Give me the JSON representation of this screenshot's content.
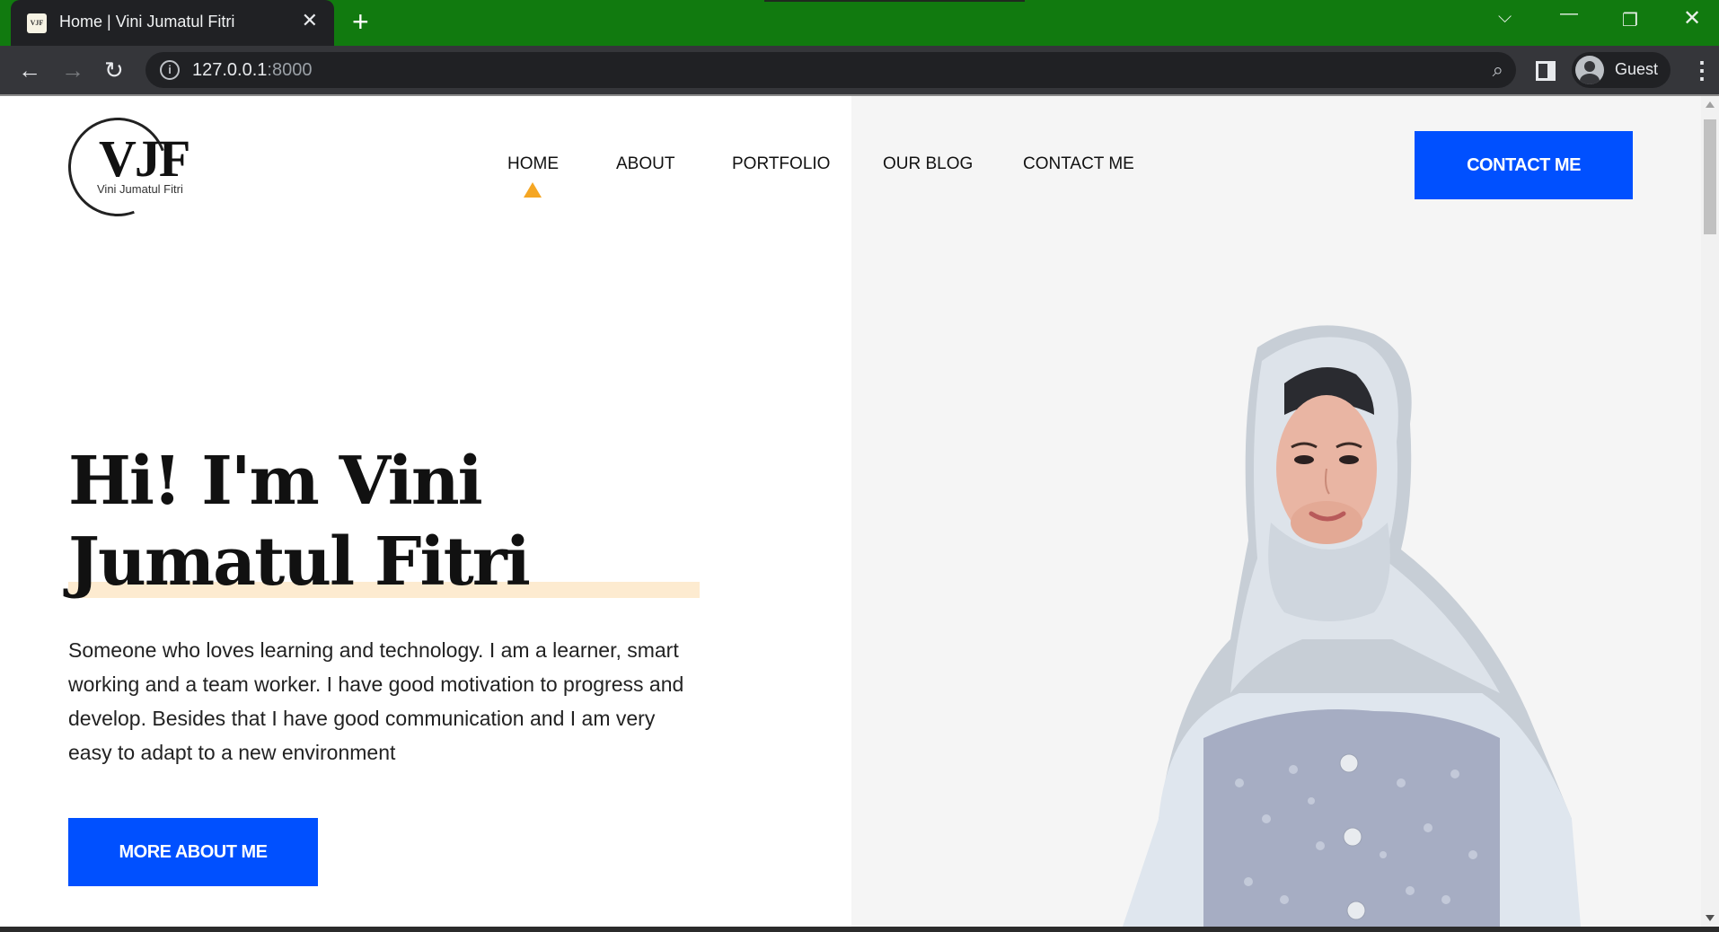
{
  "browser": {
    "tab_title": "Home | Vini Jumatul Fitri",
    "favicon_text": "VJF",
    "url_host": "127.0.0.1",
    "url_port": ":8000",
    "profile_label": "Guest",
    "titlebar_color": "#117a0f"
  },
  "site": {
    "logo_text": "VJF",
    "logo_subtitle": "Vini Jumatul Fitri",
    "nav": [
      {
        "label": "HOME",
        "active": true
      },
      {
        "label": "ABOUT"
      },
      {
        "label": "PORTFOLIO"
      },
      {
        "label": "OUR BLOG"
      },
      {
        "label": "CONTACT ME"
      }
    ],
    "cta_label": "CONTACT ME",
    "accent_color": "#0050ff",
    "nav_indicator_color": "#f5a623"
  },
  "hero": {
    "title": "Hi! I'm Vini Jumatul Fitri",
    "description": "Someone who loves learning and technology. I am a learner, smart working and a team worker. I have good motivation to progress and develop. Besides that I have good communication and I am very easy to adapt to a new environment",
    "button_label": "MORE ABOUT ME"
  }
}
